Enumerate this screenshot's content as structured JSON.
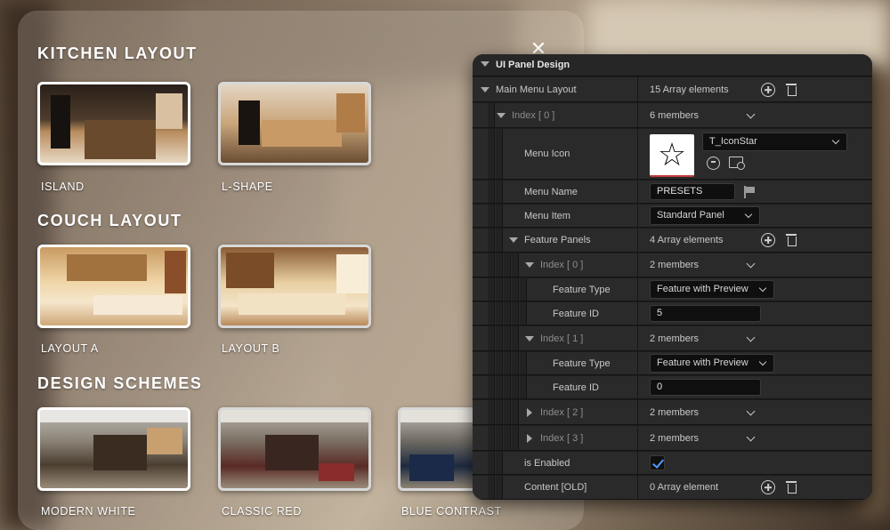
{
  "menu": {
    "close_glyph": "✕",
    "sections": [
      {
        "title": "KITCHEN LAYOUT",
        "items": [
          {
            "label": "ISLAND"
          },
          {
            "label": "L-SHAPE"
          }
        ]
      },
      {
        "title": "COUCH LAYOUT",
        "items": [
          {
            "label": "LAYOUT A"
          },
          {
            "label": "LAYOUT B"
          }
        ]
      },
      {
        "title": "DESIGN SCHEMES",
        "items": [
          {
            "label": "MODERN WHITE"
          },
          {
            "label": "CLASSIC RED"
          },
          {
            "label": "BLUE CONTRAST"
          }
        ]
      }
    ]
  },
  "details": {
    "title": "UI Panel Design",
    "main_menu_layout": {
      "name": "Main Menu Layout",
      "value": "15 Array elements"
    },
    "index0": {
      "name": "Index [ 0 ]",
      "value": "6 members"
    },
    "menu_icon": {
      "name": "Menu Icon",
      "asset": "T_IconStar",
      "glyph": "☆"
    },
    "menu_name": {
      "name": "Menu Name",
      "value": "PRESETS"
    },
    "menu_item": {
      "name": "Menu Item",
      "value": "Standard Panel"
    },
    "feature_panels": {
      "name": "Feature Panels",
      "value": "4 Array elements"
    },
    "fp_index0": {
      "name": "Index [ 0 ]",
      "value": "2 members"
    },
    "fp0_type": {
      "name": "Feature Type",
      "value": "Feature with Preview"
    },
    "fp0_id": {
      "name": "Feature ID",
      "value": "5"
    },
    "fp_index1": {
      "name": "Index [ 1 ]",
      "value": "2 members"
    },
    "fp1_type": {
      "name": "Feature Type",
      "value": "Feature with Preview"
    },
    "fp1_id": {
      "name": "Feature ID",
      "value": "0"
    },
    "fp_index2": {
      "name": "Index [ 2 ]",
      "value": "2 members"
    },
    "fp_index3": {
      "name": "Index [ 3 ]",
      "value": "2 members"
    },
    "is_enabled": {
      "name": "is Enabled",
      "checked": true
    },
    "content_old": {
      "name": "Content [OLD]",
      "value": "0 Array element"
    }
  },
  "colors": {
    "panel_bg": "#1c1c1c",
    "row_bg": "#2a2a2a",
    "checkbox_accent": "#4a9cff",
    "asset_underline": "#c23b3b"
  }
}
